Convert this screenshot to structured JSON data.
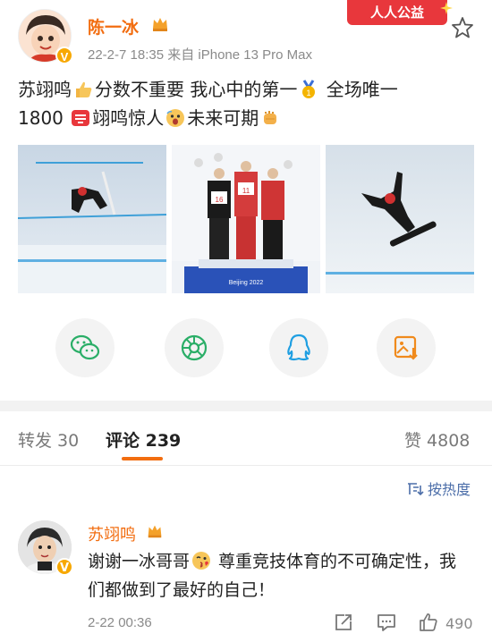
{
  "post": {
    "author": "陈一冰",
    "meta": "22-2-7 18:35  来自 iPhone 13 Pro Max",
    "charity_tag": "人人公益",
    "text_line1_a": "苏翊鸣",
    "text_line1_b": "分数不重要 我心中的第一",
    "text_line1_c": "全场唯一",
    "text_line2_a": "1800",
    "text_line2_b": "翊鸣惊人",
    "text_line2_c": "未来可期"
  },
  "share_icons": [
    "wechat-icon",
    "moments-icon",
    "qq-icon",
    "save-image-icon"
  ],
  "tabs": {
    "repost": "转发 30",
    "comments": "评论 239",
    "likes": "赞 4808"
  },
  "sort_label": "按热度",
  "comment": {
    "author": "苏翊鸣",
    "text_a": "谢谢一冰哥哥",
    "text_b": " 尊重竞技体育的不可确定性，我们都做到了最好的自己！",
    "time": "2-22 00:36",
    "like_count": "490"
  },
  "colors": {
    "accent": "#f26d10",
    "link": "#4c6ea9",
    "charity": "#e8373c"
  }
}
